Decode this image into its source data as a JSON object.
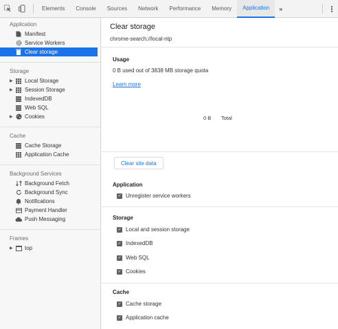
{
  "toolbar": {
    "inspect_icon": "inspect-element-icon",
    "device_icon": "device-toggle-icon",
    "tabs": [
      "Elements",
      "Console",
      "Sources",
      "Network",
      "Performance",
      "Memory",
      "Application"
    ],
    "active_tab": "Application",
    "more_label": "»",
    "menu_label": "⋮"
  },
  "sidebar": {
    "application": {
      "title": "Application",
      "items": [
        "Manifest",
        "Service Workers",
        "Clear storage"
      ]
    },
    "storage": {
      "title": "Storage",
      "items": [
        "Local Storage",
        "Session Storage",
        "IndexedDB",
        "Web SQL",
        "Cookies"
      ]
    },
    "cache": {
      "title": "Cache",
      "items": [
        "Cache Storage",
        "Application Cache"
      ]
    },
    "background": {
      "title": "Background Services",
      "items": [
        "Background Fetch",
        "Background Sync",
        "Notifications",
        "Payment Handler",
        "Push Messaging"
      ]
    },
    "frames": {
      "title": "Frames",
      "items": [
        "top"
      ]
    }
  },
  "main": {
    "title": "Clear storage",
    "origin": "chrome-search://local-ntp",
    "usage": {
      "heading": "Usage",
      "text": "0 B used out of 3838 MB storage quota",
      "learn_more": "Learn more",
      "total_value": "0 B",
      "total_label": "Total"
    },
    "clear_button": "Clear site data",
    "sections": {
      "application": {
        "heading": "Application",
        "options": [
          "Unregister service workers"
        ]
      },
      "storage": {
        "heading": "Storage",
        "options": [
          "Local and session storage",
          "IndexedDB",
          "Web SQL",
          "Cookies"
        ]
      },
      "cache": {
        "heading": "Cache",
        "options": [
          "Cache storage",
          "Application cache"
        ]
      }
    }
  }
}
